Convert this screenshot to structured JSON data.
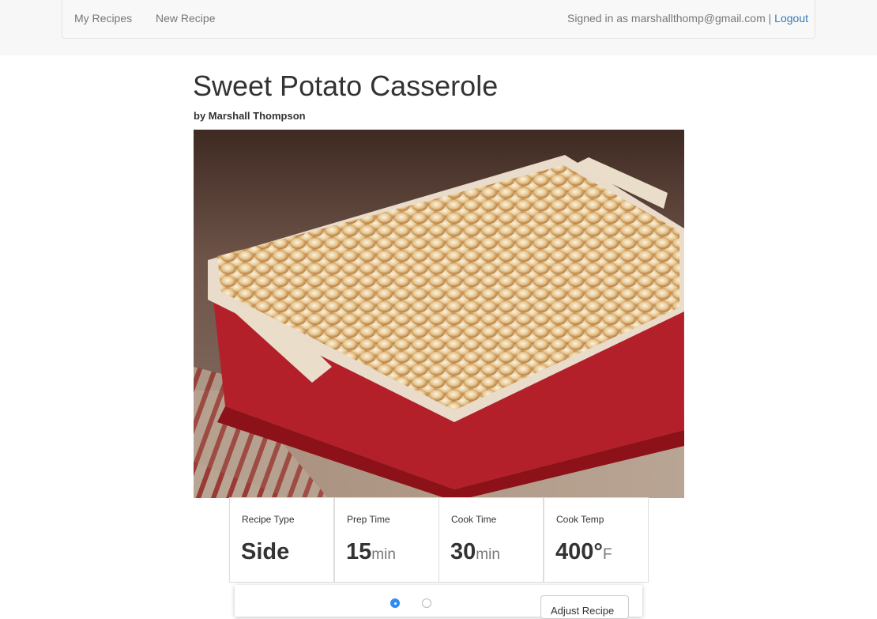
{
  "nav": {
    "my_recipes": "My Recipes",
    "new_recipe": "New Recipe",
    "signed_in_text": "Signed in as marshallthomp@gmail.com |",
    "logout": "Logout"
  },
  "recipe": {
    "title": "Sweet Potato Casserole",
    "author": "by Marshall Thompson",
    "photo_alt": "Sweet potato casserole topped with toasted marshmallows in a red baking dish"
  },
  "stats": [
    {
      "label": "Recipe Type",
      "value": "Side",
      "unit": ""
    },
    {
      "label": "Prep Time",
      "value": "15",
      "unit": "min"
    },
    {
      "label": "Cook Time",
      "value": "30",
      "unit": "min"
    },
    {
      "label": "Cook Temp",
      "value": "400°",
      "unit": "F"
    }
  ],
  "controls": {
    "radio_selected_index": 0,
    "adjust_button": "Adjust Recipe"
  },
  "colors": {
    "link": "#337ab7",
    "dish_red": "#b3202a",
    "radio_accent": "#2f8cf0"
  }
}
